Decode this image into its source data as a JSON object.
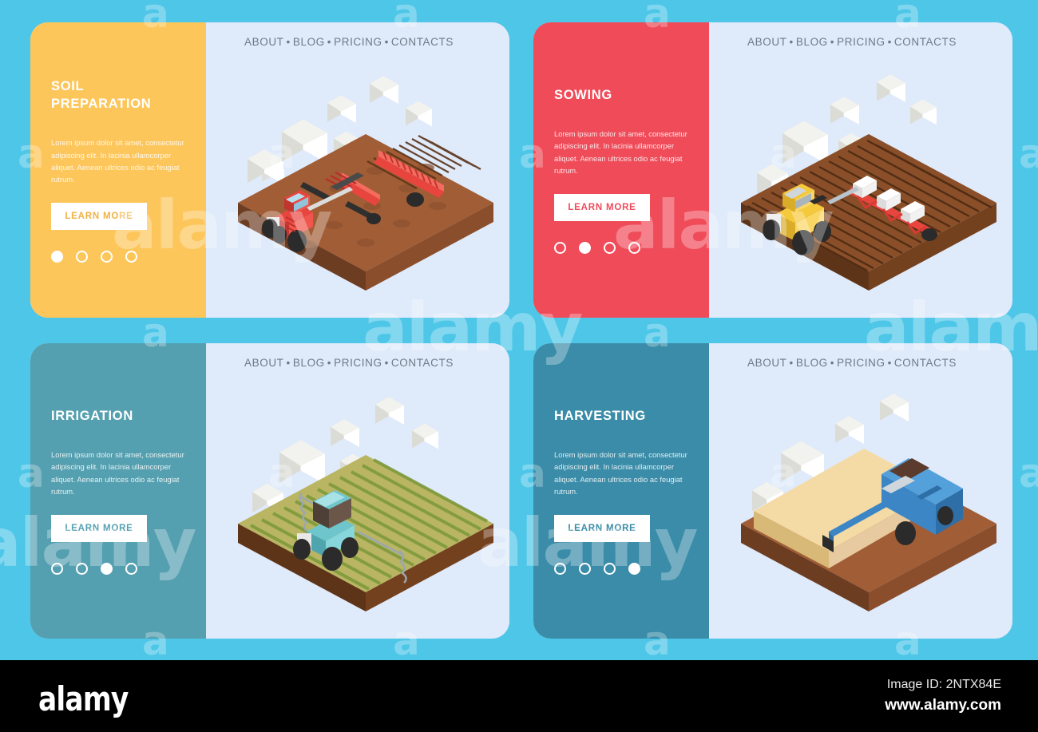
{
  "background_color": "#4ec6e8",
  "panel_bg_light": "#dfeafa",
  "nav": {
    "items": [
      "ABOUT",
      "BLOG",
      "PRICING",
      "CONTACTS"
    ],
    "separator": "•",
    "text": "ABOUT • BLOG • PRICING • CONTACTS"
  },
  "shared": {
    "body_text": "Lorem ipsum dolor sit amet, consectetur adipiscing elit. In lacinia ullamcorper aliquet. Aenean ultrices odio ac feugiat rutrum.",
    "button_label": "LEARN MORE",
    "dot_count": 4
  },
  "cards": [
    {
      "id": "soil-preparation",
      "title": "SOIL\nPREPARATION",
      "title_line1": "SOIL",
      "title_line2": "PREPARATION",
      "accent_color": "#fdc65b",
      "button_text_color": "#f0b243",
      "active_dot": 1,
      "scene": "red-tractor-harrow-on-brown-field"
    },
    {
      "id": "sowing",
      "title": "SOWING",
      "title_line1": "SOWING",
      "title_line2": "",
      "accent_color": "#ef4b59",
      "button_text_color": "#ef4b59",
      "active_dot": 2,
      "scene": "yellow-tractor-seeder-on-ploughed-field"
    },
    {
      "id": "irrigation",
      "title": "IRRIGATION",
      "title_line1": "IRRIGATION",
      "title_line2": "",
      "accent_color": "#55a0b0",
      "button_text_color": "#55a0b0",
      "active_dot": 3,
      "scene": "blue-tractor-sprinkler-on-green-field"
    },
    {
      "id": "harvesting",
      "title": "HARVESTING",
      "title_line1": "HARVESTING",
      "title_line2": "",
      "accent_color": "#3a8ca8",
      "button_text_color": "#3a8ca8",
      "active_dot": 4,
      "scene": "blue-combine-harvester-on-wheat-field"
    }
  ],
  "footer": {
    "logo": "alamy",
    "image_id": "Image ID: 2NTX84E",
    "website": "www.alamy.com"
  },
  "watermark": {
    "letter": "a",
    "word": "alamy"
  }
}
